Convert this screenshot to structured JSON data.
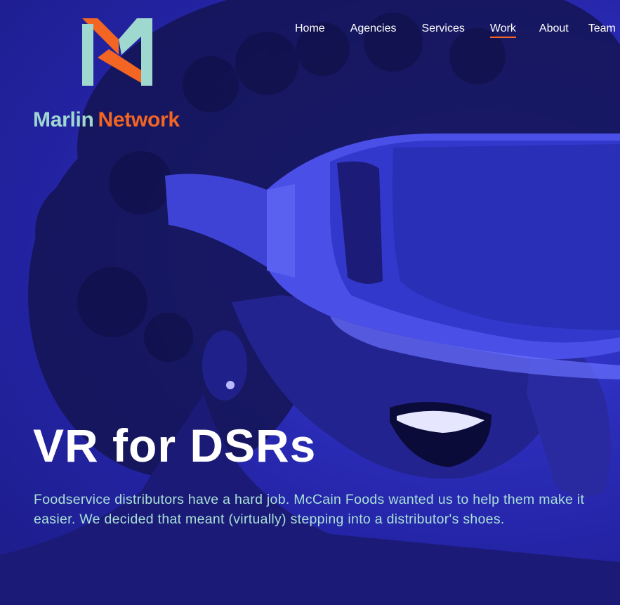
{
  "brand": {
    "name_part1": "Marlin",
    "name_part2": "Network",
    "logo_icon": "marlin-m-logo",
    "colors": {
      "teal": "#9fd8cf",
      "orange": "#f26522",
      "background": "#2a2ab0"
    }
  },
  "nav": {
    "items": [
      {
        "label": "Home",
        "active": false
      },
      {
        "label": "Agencies",
        "active": false
      },
      {
        "label": "Services",
        "active": false
      },
      {
        "label": "Work",
        "active": true
      },
      {
        "label": "About",
        "active": false
      },
      {
        "label": "Team",
        "active": false
      }
    ]
  },
  "hero": {
    "image": "vr-headset-smiling-woman-photo",
    "title": "VR for DSRs",
    "description": "Foodservice distributors have a hard job. McCain Foods wanted us to help them make it easier. We decided that meant (virtually) stepping into a distributor's shoes."
  }
}
